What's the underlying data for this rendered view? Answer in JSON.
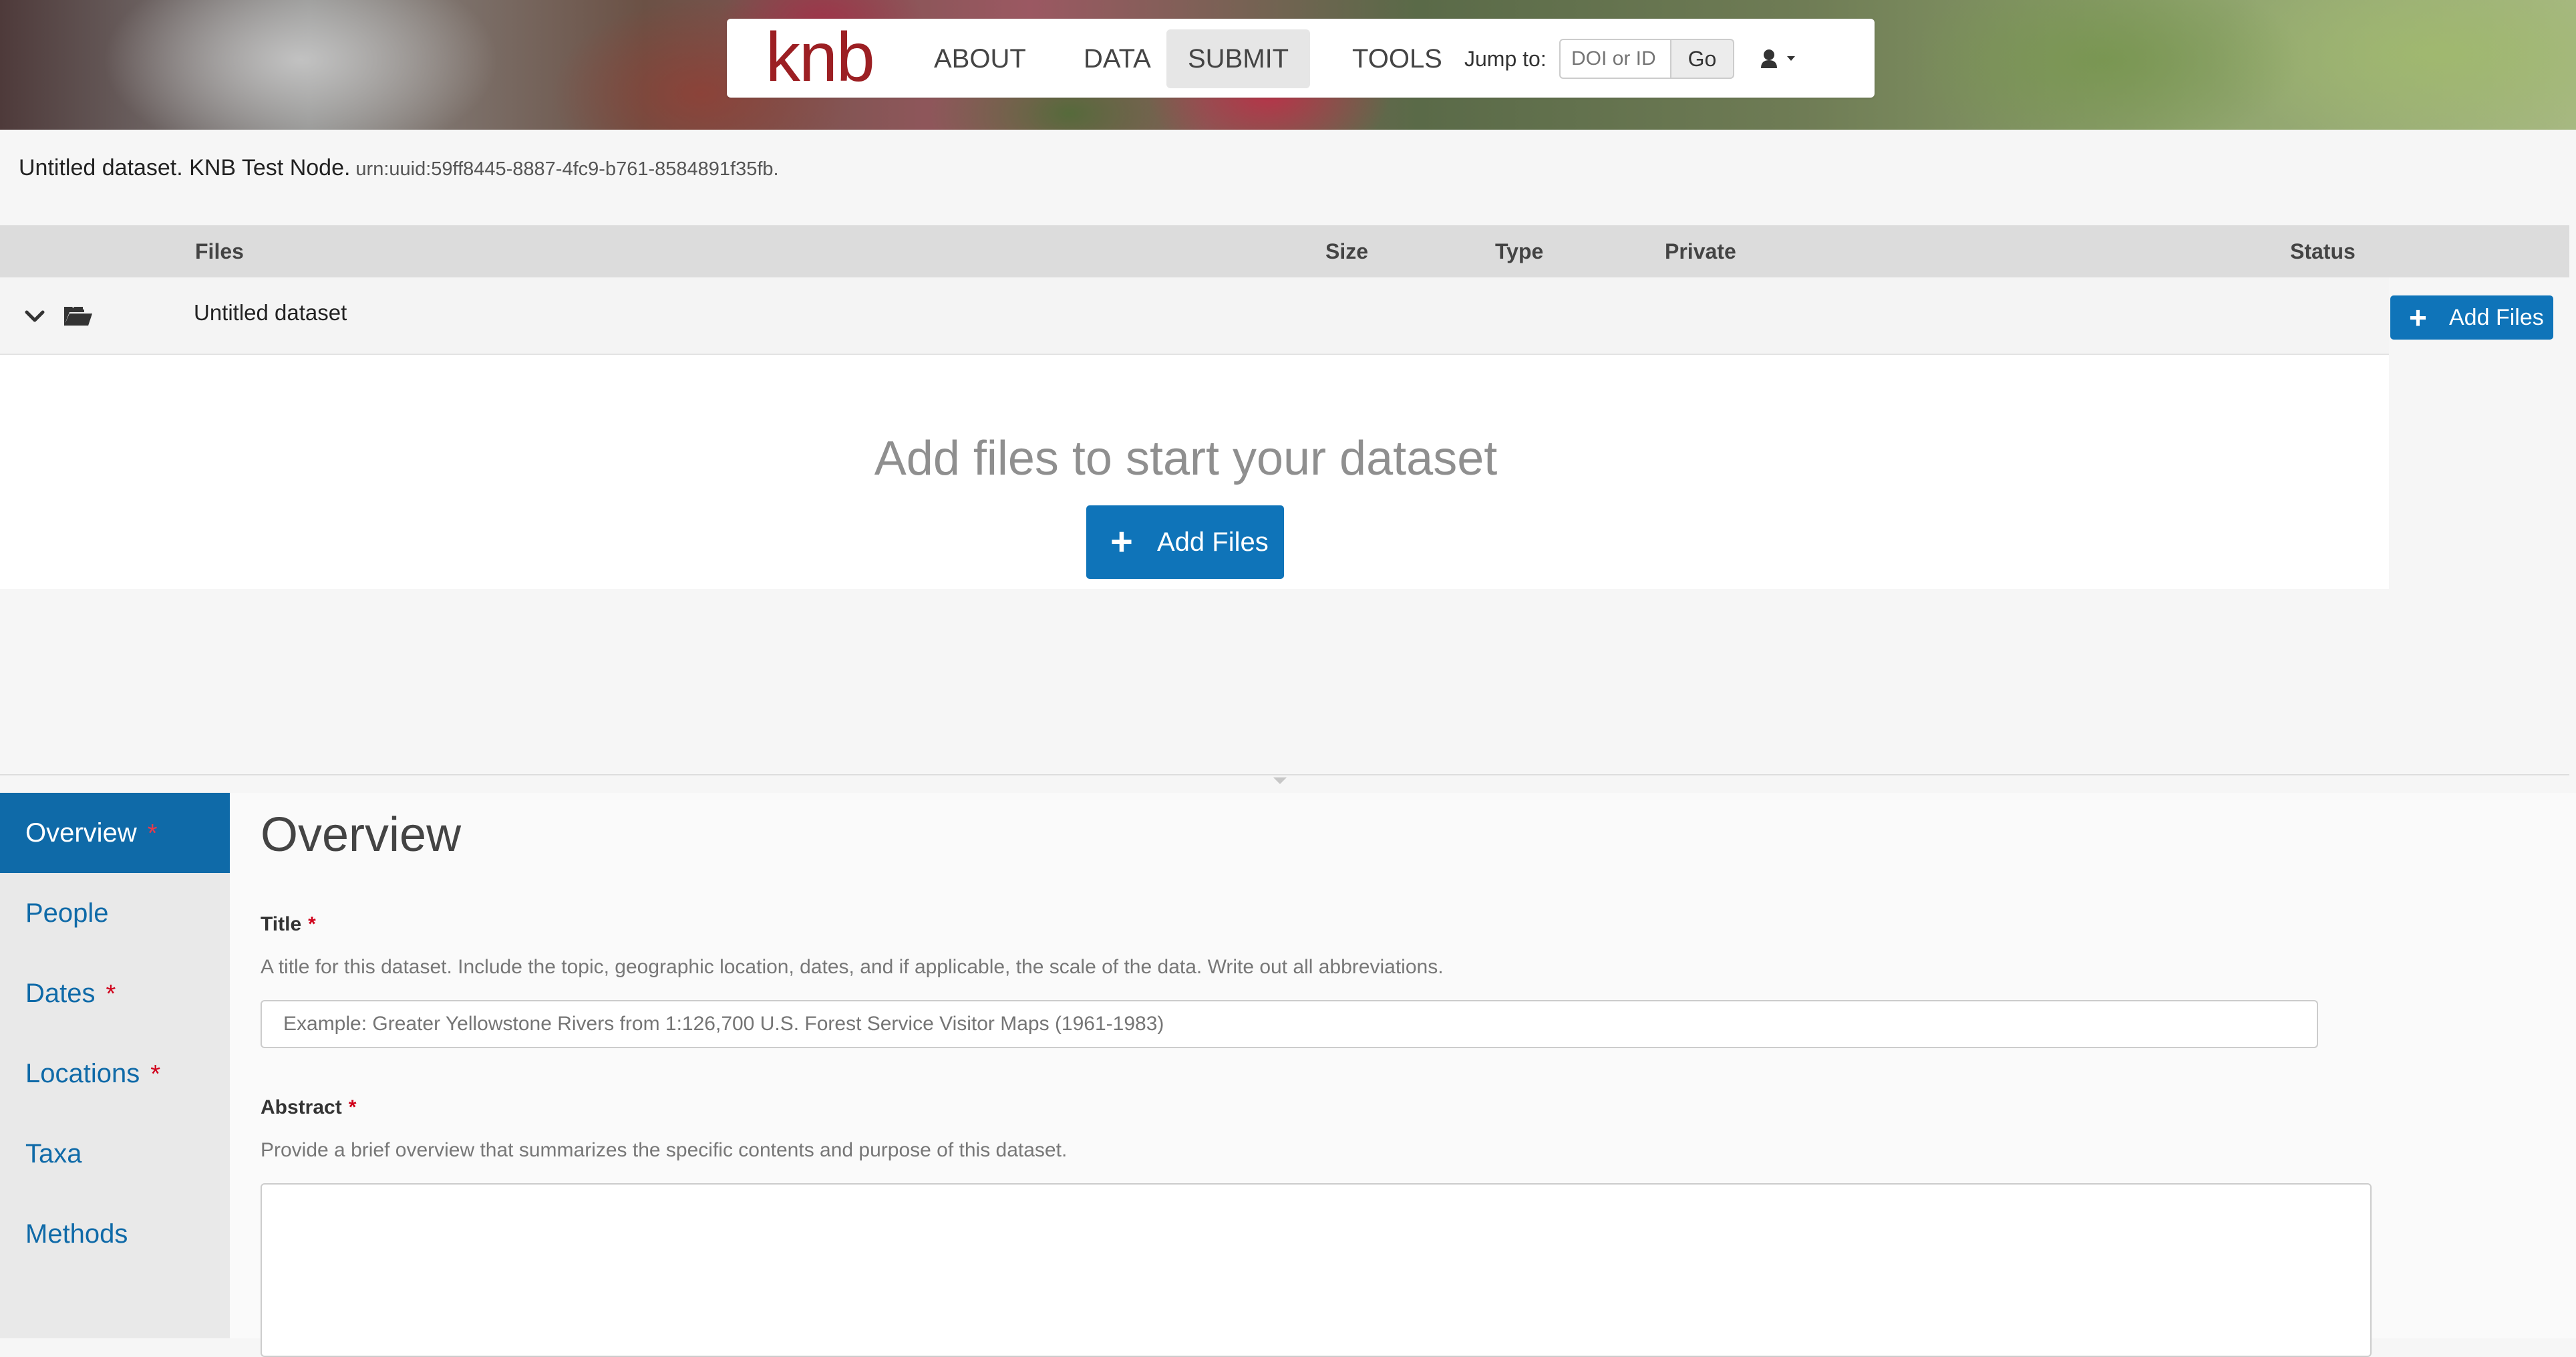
{
  "navbar": {
    "logo": "knb",
    "items": [
      "ABOUT",
      "DATA",
      "SUBMIT",
      "TOOLS"
    ],
    "active_item": "SUBMIT",
    "jump_label": "Jump to:",
    "jump_placeholder": "DOI or ID",
    "go_label": "Go",
    "user_icon": "user-icon",
    "caret_icon": "caret-down-icon"
  },
  "citation": {
    "text": "Untitled dataset. KNB Test Node.",
    "identifier": "urn:uuid:59ff8445-8887-4fc9-b761-8584891f35fb."
  },
  "files_table": {
    "headers": {
      "files": "Files",
      "size": "Size",
      "type": "Type",
      "private": "Private",
      "status": "Status"
    },
    "row": {
      "name": "Untitled dataset",
      "expand_icon": "chevron-down-icon",
      "folder_icon": "folder-open-icon"
    },
    "add_files_label": "Add Files"
  },
  "empty_state": {
    "message": "Add files to start your dataset",
    "button_label": "Add Files"
  },
  "sidebar": {
    "items": [
      {
        "label": "Overview",
        "required": "*"
      },
      {
        "label": "People",
        "required": ""
      },
      {
        "label": "Dates",
        "required": "*"
      },
      {
        "label": "Locations",
        "required": "*"
      },
      {
        "label": "Taxa",
        "required": ""
      },
      {
        "label": "Methods",
        "required": ""
      }
    ],
    "active": "Overview"
  },
  "overview": {
    "heading": "Overview",
    "title_label": "Title",
    "title_required": "*",
    "title_help": "A title for this dataset. Include the topic, geographic location, dates, and if applicable, the scale of the data. Write out all abbreviations.",
    "title_placeholder": "Example: Greater Yellowstone Rivers from 1:126,700 U.S. Forest Service Visitor Maps (1961-1983)",
    "abstract_label": "Abstract",
    "abstract_required": "*",
    "abstract_help": "Provide a brief overview that summarizes the specific contents and purpose of this dataset.",
    "abstract_value": ""
  },
  "colors": {
    "brand_red": "#9c1f23",
    "primary_blue": "#0f74b9",
    "sidebar_active": "#0f6aa8",
    "required_red": "#d0021b"
  }
}
